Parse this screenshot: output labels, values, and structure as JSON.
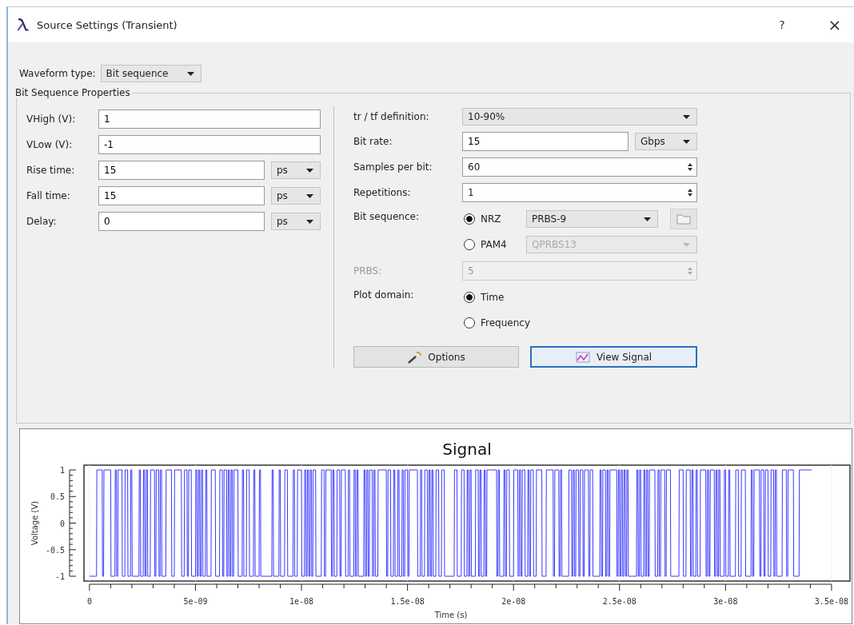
{
  "window": {
    "title": "Source Settings (Transient)",
    "help": "?",
    "close": "×"
  },
  "waveform_type": {
    "label": "Waveform type:",
    "value": "Bit sequence"
  },
  "group": {
    "title": "Bit Sequence Properties",
    "left_rows": [
      {
        "kind": "input",
        "label": "VHigh (V):",
        "value": "1"
      },
      {
        "kind": "input",
        "label": "VLow (V):",
        "value": "-1"
      },
      {
        "kind": "input_unit",
        "label": "Rise time:",
        "value": "15",
        "unit": "ps"
      },
      {
        "kind": "input_unit",
        "label": "Fall time:",
        "value": "15",
        "unit": "ps"
      },
      {
        "kind": "input_unit",
        "label": "Delay:",
        "value": "0",
        "unit": "ps"
      }
    ],
    "right_rows": [
      {
        "kind": "select",
        "label": "tr / tf definition:",
        "value": "10-90%"
      },
      {
        "kind": "input_unit",
        "label": "Bit rate:",
        "value": "15",
        "unit": "Gbps"
      },
      {
        "kind": "spin",
        "label": "Samples per bit:",
        "value": "60",
        "disabled": false
      },
      {
        "kind": "spin",
        "label": "Repetitions:",
        "value": "1",
        "disabled": false
      },
      {
        "kind": "radio_group",
        "label": "Bit sequence:",
        "options": [
          {
            "label": "NRZ",
            "selected": true,
            "select": {
              "value": "PRBS-9",
              "disabled": false
            },
            "file_button": true
          },
          {
            "label": "PAM4",
            "selected": false,
            "select": {
              "value": "QPRBS13",
              "disabled": true
            },
            "file_button": false
          }
        ]
      },
      {
        "kind": "spin",
        "label": "PRBS:",
        "value": "5",
        "disabled": true
      },
      {
        "kind": "radio_group",
        "label": "Plot domain:",
        "options": [
          {
            "label": "Time",
            "selected": true
          },
          {
            "label": "Frequency",
            "selected": false
          }
        ]
      }
    ],
    "buttons": [
      {
        "kind": "options",
        "label": "Options",
        "focused": false
      },
      {
        "kind": "view",
        "label": "View Signal",
        "focused": true
      }
    ]
  },
  "chart_data": {
    "type": "line",
    "grid": true,
    "title": "Signal",
    "xlabel": "Time (s)",
    "ylabel": "Voltage (V)",
    "xlim": [
      -2.6e-10,
      3.587e-08
    ],
    "ylim": [
      -1.09,
      1.09
    ],
    "xticks": [
      {
        "value": 0,
        "label": "0"
      },
      {
        "value": 5e-09,
        "label": "5e-09"
      },
      {
        "value": 1e-08,
        "label": "1e-08"
      },
      {
        "value": 1.5e-08,
        "label": "1.5e-08"
      },
      {
        "value": 2e-08,
        "label": "2e-08"
      },
      {
        "value": 2.5e-08,
        "label": "2.5e-08"
      },
      {
        "value": 3e-08,
        "label": "3e-08"
      },
      {
        "value": 3.5e-08,
        "label": "3.5e-08"
      }
    ],
    "yticks": [
      {
        "value": 1,
        "label": "1"
      },
      {
        "value": 0.5,
        "label": "0.5"
      },
      {
        "value": 0,
        "label": "0"
      },
      {
        "value": -0.5,
        "label": "-0.5"
      },
      {
        "value": -1,
        "label": "-1"
      }
    ]
  }
}
